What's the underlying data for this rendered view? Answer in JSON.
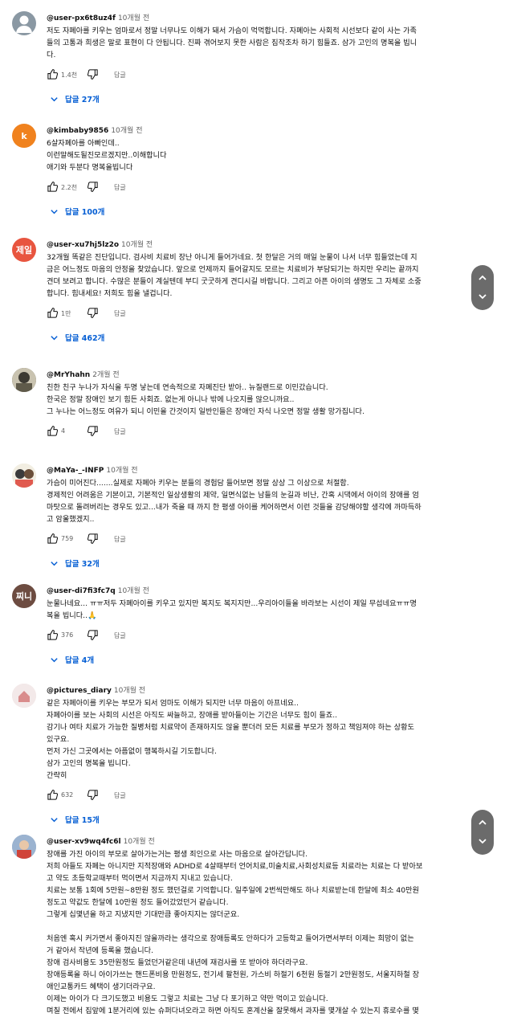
{
  "actions": {
    "reply_label": "답글"
  },
  "comments": [
    {
      "author": "@user-px6t8uz4f",
      "time": "10개월 전",
      "avatar": {
        "kind": "person-icon",
        "color": "#8a98a3",
        "text": ""
      },
      "lines": [
        "저도 자폐아를 키우는 엄마로서 정말 너무나도 이해가 돼서 가슴이 먹먹합니다. 자폐아는 사회적 시선보다 같이 사는 가족",
        "들의 고통과 희생은 말로 표현이 다 안됩니다. 진짜 겪어보지 못한 사람은 짐작조차 하기 힘들죠. 삼가 고인의 명복을 빕니",
        "다."
      ],
      "likes": "1.4천",
      "replies": "답글 27개"
    },
    {
      "author": "@kimbaby9856",
      "time": "10개월 전",
      "avatar": {
        "kind": "letter",
        "color": "#f0821e",
        "text": "k"
      },
      "lines": [
        "6살자폐아를 아빠인데..",
        "이런말해도될진모르겠지만..이해합니다",
        "애기와 두분다 명복을빕니다"
      ],
      "likes": "2.2천",
      "replies": "답글 100개"
    },
    {
      "author": "@user-xu7hj5lz2o",
      "time": "10개월 전",
      "avatar": {
        "kind": "letter",
        "color": "#e8553f",
        "text": "제일"
      },
      "lines": [
        "32개월 똑같은 진단입니다. 검사비 치료비 장난 아니게 들어가네요. 첫 한달은 거의 매일 눈물이 나서 너무 힘들었는데 지",
        "금은 어느정도 마음의 안정을 찾았습니다. 앞으로 언제까지 들어갈지도 모르는 치료비가 부담되기는 하지만 우리는 끝까지",
        "견뎌 보려고 합니다. 수많은 분들이 계실텐데 부디 굿굿하게 견디시길 바랍니다. 그리고 아픈 아이의 생명도 그 자체로 소중",
        "합니다. 힘내세요! 저희도 힘을 낼겁니다."
      ],
      "likes": "1만",
      "replies": "답글 462개"
    },
    {
      "author": "@MrYhahn",
      "time": "2개월 전",
      "avatar": {
        "kind": "photo",
        "color": "#5f5a4a",
        "text": ""
      },
      "lines": [
        "친한 친구 누나가 자식을 두명 낳는데 연속적으로 자폐진단 받아.. 뉴질랜드로 이민갔습니다.",
        "한국은 정말 장애인 보기 힘든 사회죠. 없는게 아니나 밖에 나오지를 않으니까요..",
        "그 누나는 어느정도 여유가 되니 이민을 간것이지 일반인들은 장애인 자식 나오면 정말 생활 망가집니다."
      ],
      "likes": "4",
      "replies": ""
    },
    {
      "author": "@MaYa-_-INFP",
      "time": "10개월 전",
      "avatar": {
        "kind": "cartoon",
        "color": "#e9e4d4",
        "text": ""
      },
      "lines": [
        "가슴이 미어진다.......실제로 자폐아 키우는 분들의 경험담 들어보면 정말 상상 그 이상으로 처절함.",
        "경제적인 어려움은 기본이고, 기본적인 일상생활의 제약, 일면식없는 남들의 눈길과 비난, 간혹 시댁에서 아이의 장애를 엄",
        "마탓으로 돌려버리는 경우도 있고...내가 죽을 때 까지 한 평생 아이를 케어하면서 이런 것들을 감당해야할 생각에 까마득하",
        "고 암울했겠지.."
      ],
      "likes": "759",
      "replies": "답글 32개"
    },
    {
      "author": "@user-di7fi3fc7q",
      "time": "10개월 전",
      "avatar": {
        "kind": "letter",
        "color": "#6d4c41",
        "text": "찌니"
      },
      "lines": [
        "눈물나네요... ㅠㅠ저두 자폐아이를 키우고 있지만 복지도 복지지만...우리아이들을 바라보는 시선이 제일 무섭네요ㅠㅠ명",
        "복을 빕니다..🙏"
      ],
      "likes": "376",
      "replies": "답글 4개"
    },
    {
      "author": "@pictures_diary",
      "time": "10개월 전",
      "avatar": {
        "kind": "house",
        "color": "#efe3e3",
        "text": ""
      },
      "lines": [
        "같은 자폐아이를 키우는 부모가 되서 엄마도 이해가 되지만 너무 마음이 아프네요..",
        "자폐아이를 보는 사회의 시선은 아직도 싸늘하고, 장애를 받아들이는 기간은 너무도 힘이 들죠..",
        "감기나 여타 치료가 가능한 질병처럼 치료약이 존재하지도 않을 뿐더러 모든 치료를 부모가 정하고 책임져야 하는 상황도",
        "있구요.",
        "먼저 가신 그곳에서는 아픔없이 행복하시길 기도합니다.",
        "삼가 고인의 명복을 빕니다.",
        "간략히"
      ],
      "likes": "632",
      "replies": "답글 15개"
    },
    {
      "author": "@user-xv9wq4fc6l",
      "time": "10개월 전",
      "avatar": {
        "kind": "photo2",
        "color": "#8fa8c8",
        "text": ""
      },
      "lines": [
        "장애를 가진 아이의 부모로 살아가는거는 평생 죄인으로 사는 마음으로 살아간답니다.",
        "저희 아들도 자폐는 아니지만 지적장애와 ADHD로 4살때부터 언어치료,미술치료,사회성치료등 치료라는 치료는 다 받아보",
        "고 약도 초등학교때부터 먹이면서 지금까지 지내고 있습니다.",
        "치료는 보통 1회에 5만원~8만원 정도 했던걸로 기억합니다. 일주일에 2번씩만해도 하나 치료받는데 한달에 최소 40만원",
        "정도고 약값도 한달에 10만원 정도 들어갔었던거 같습니다.",
        "그렇게 십몇년을 하고 지냈지만 기대만큼 좋아지지는 않더군요.",
        "",
        "처음엔 혹시 커가면서 좋아지진 않을까라는 생각으로 장애등록도 안하다가 고등학교 들어가면서부터 이제는 희망이 없는",
        "거 같아서 작년에 등록을 했습니다.",
        "장애 검사비용도 35만원정도 들었던거같은데 내년에 재검사를 또 받아야 하더라구요.",
        "장애등록을 하니 아이가쓰는 핸드폰비용 만원정도, 전기세 팔천원, 가스비 하절기 6천원 동절기 2만원정도, 서울지하철 장",
        "애인교통카드 혜택이 생기더라구요.",
        "이제는 아이가 다 크기도했고 비용도 그렇고 치료는 그냥 다 포기하고 약만 먹이고 있습니다.",
        "며칠 전에서 집앞에 1분거리에 있는 슈퍼다녀오라고 하면 아직도 혼계산을 잘못해서 과자를 몇개살 수 있는지 휴로수를 몇"
      ],
      "likes": "",
      "replies": ""
    }
  ]
}
